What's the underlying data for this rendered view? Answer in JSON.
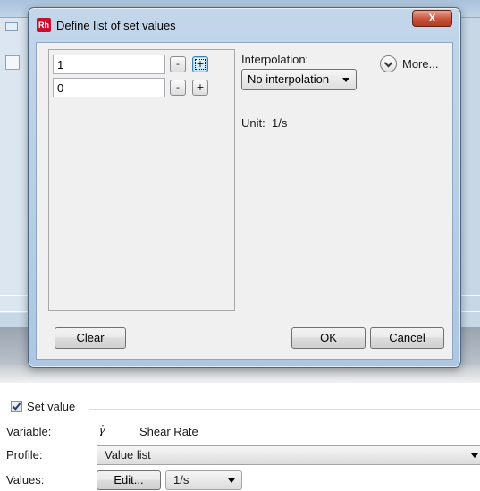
{
  "dialog": {
    "app_icon_text": "Rh",
    "title": "Define list of set values",
    "close_symbol": "X",
    "rows": [
      {
        "value": "1",
        "minus": "-",
        "plus": "+"
      },
      {
        "value": "0",
        "minus": "-",
        "plus": "+"
      }
    ],
    "interpolation_label": "Interpolation:",
    "interpolation_value": "No interpolation",
    "more_label": "More...",
    "unit_label": "Unit:",
    "unit_value": "1/s",
    "clear_label": "Clear",
    "ok_label": "OK",
    "cancel_label": "Cancel"
  },
  "set_value": {
    "checkbox_label": "Set value",
    "checked": true,
    "variable_label": "Variable:",
    "variable_symbol": "γ̇",
    "variable_name": "Shear Rate",
    "profile_label": "Profile:",
    "profile_value": "Value list",
    "values_label": "Values:",
    "edit_label": "Edit...",
    "unit_value": "1/s"
  },
  "icons": {
    "close": "close-icon",
    "more": "chevron-down-icon",
    "dropdown": "dropdown-arrow-icon",
    "check": "check-icon"
  }
}
